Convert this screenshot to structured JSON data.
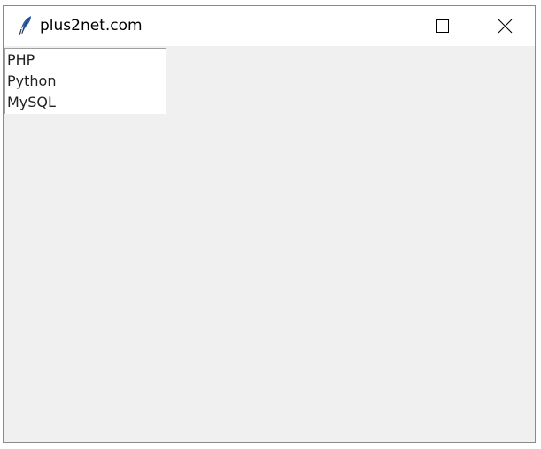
{
  "window": {
    "title": "plus2net.com",
    "icon": "feather-icon"
  },
  "controls": {
    "minimize": "minimize-icon",
    "maximize": "maximize-icon",
    "close": "close-icon"
  },
  "listbox": {
    "items": [
      "PHP",
      "Python",
      "MySQL"
    ]
  }
}
